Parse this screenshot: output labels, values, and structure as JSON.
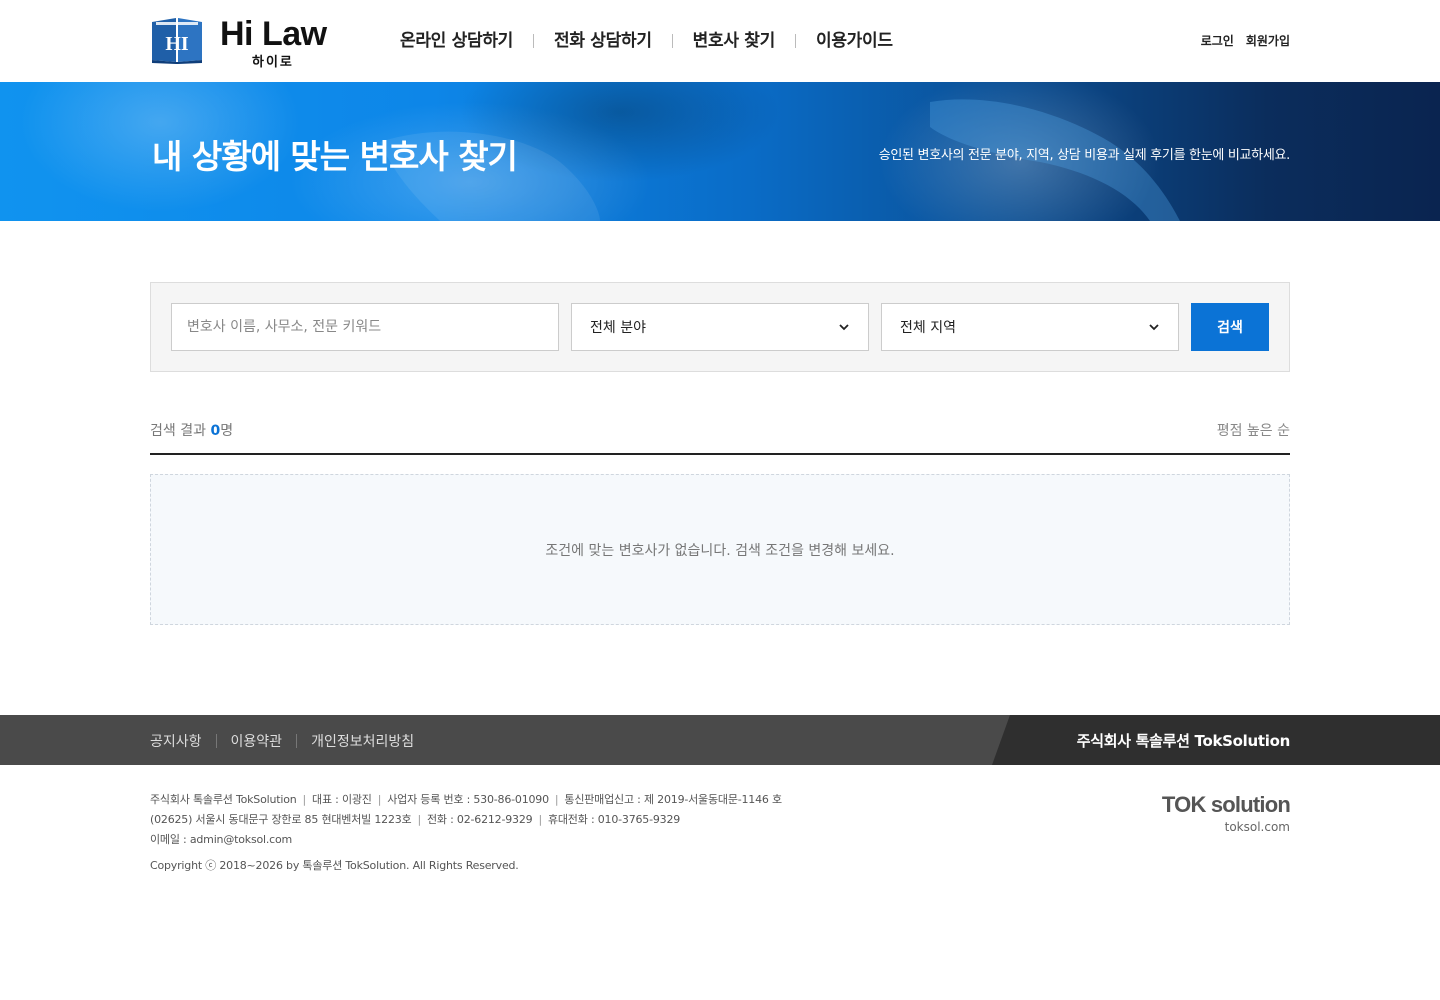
{
  "header": {
    "logo_title": "Hi Law",
    "logo_sub": "하이로",
    "logo_emblem_text": "HI",
    "nav": [
      {
        "label": "온라인 상담하기"
      },
      {
        "label": "전화 상담하기"
      },
      {
        "label": "변호사 찾기"
      },
      {
        "label": "이용가이드"
      }
    ],
    "login": "로그인",
    "signup": "회원가입"
  },
  "banner": {
    "title": "내 상황에 맞는 변호사 찾기",
    "description": "승인된 변호사의 전문 분야, 지역, 상담 비용과 실제 후기를 한눈에 비교하세요."
  },
  "search": {
    "keyword_placeholder": "변호사 이름, 사무소, 전문 키워드",
    "keyword_value": "",
    "field_selected": "전체 분야",
    "region_selected": "전체 지역",
    "button": "검색"
  },
  "results": {
    "label": "검색 결과",
    "count": "0",
    "unit": "명",
    "sort": "평점 높은 순",
    "empty_message": "조건에 맞는 변호사가 없습니다. 검색 조건을 변경해 보세요."
  },
  "footer": {
    "links": [
      {
        "label": "공지사항"
      },
      {
        "label": "이용약관"
      },
      {
        "label": "개인정보처리방침"
      }
    ],
    "company_name": "주식회사 톡솔루션 TokSolution",
    "info_line1": [
      "주식회사 톡솔루션 TokSolution",
      "대표 : 이광진",
      "사업자 등록 번호 : 530-86-01090",
      "통신판매업신고 : 제 2019-서울동대문-1146 호"
    ],
    "info_line2": [
      "(02625) 서울시 동대문구 장한로 85 현대벤처빌 1223호",
      "전화 : 02-6212-9329",
      "휴대전화 : 010-3765-9329"
    ],
    "email": "이메일 : admin@toksol.com",
    "copyright": "Copyright ⓒ 2018~2026 by 톡솔루션 TokSolution. All Rights Reserved.",
    "tok_logo": "TOK solution",
    "tok_url": "toksol.com"
  },
  "colors": {
    "accent": "#0b73d6",
    "banner_start": "#1093ef",
    "banner_end": "#0a2450",
    "footer_bar": "#4a4a4a",
    "footer_dark": "#2f2f2f"
  }
}
